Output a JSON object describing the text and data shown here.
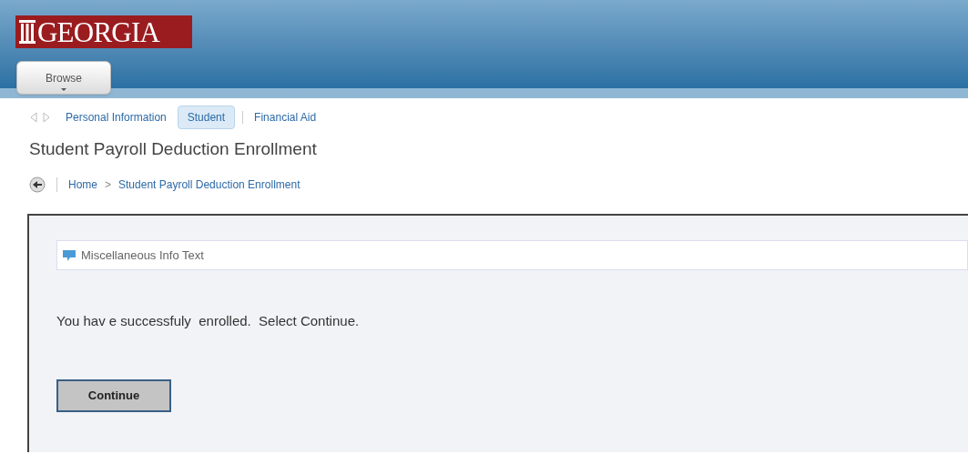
{
  "header": {
    "logo": "GEORGIA",
    "menu_button": "Browse"
  },
  "nav_tabs": [
    {
      "label": "Personal Information",
      "selected": false
    },
    {
      "label": "Student",
      "selected": true
    },
    {
      "label": "Financial Aid",
      "selected": false
    }
  ],
  "page_title": "Student Payroll Deduction Enrollment",
  "breadcrumb": {
    "separator": ">",
    "items": [
      "Home",
      "Student Payroll Deduction Enrollment"
    ]
  },
  "info_box": {
    "text": "Miscellaneous Info Text"
  },
  "message": "You hav e successfuly  enrolled.  Select Continue.",
  "buttons": [
    "Continue"
  ]
}
